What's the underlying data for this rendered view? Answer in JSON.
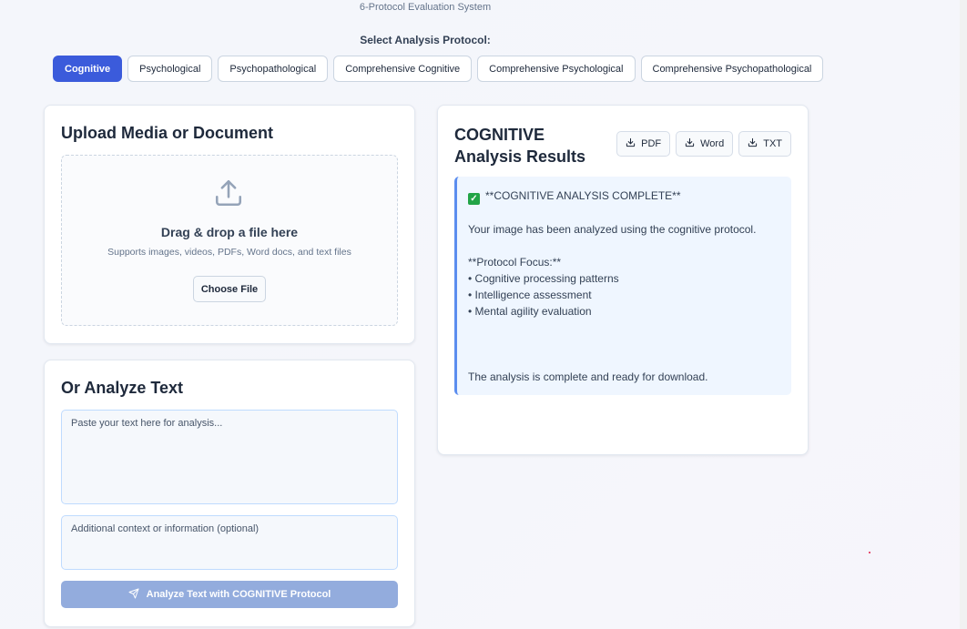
{
  "header": {
    "subtitle": "6-Protocol Evaluation System",
    "protocol_label": "Select Analysis Protocol:"
  },
  "protocols": [
    {
      "label": "Cognitive",
      "active": true
    },
    {
      "label": "Psychological",
      "active": false
    },
    {
      "label": "Psychopathological",
      "active": false
    },
    {
      "label": "Comprehensive Cognitive",
      "active": false
    },
    {
      "label": "Comprehensive Psychological",
      "active": false
    },
    {
      "label": "Comprehensive Psychopathological",
      "active": false
    }
  ],
  "upload": {
    "title": "Upload Media or Document",
    "drop_title": "Drag & drop a file here",
    "drop_subtitle": "Supports images, videos, PDFs, Word docs, and text files",
    "choose_label": "Choose File",
    "icon": "upload-icon"
  },
  "text_analysis": {
    "title": "Or Analyze Text",
    "text_placeholder": "Paste your text here for analysis...",
    "context_placeholder": "Additional context or information (optional)",
    "analyze_label": "Analyze Text with COGNITIVE Protocol",
    "analyze_icon": "send-icon"
  },
  "results": {
    "title": "COGNITIVE Analysis Results",
    "downloads": [
      {
        "label": "PDF",
        "icon": "download-icon"
      },
      {
        "label": "Word",
        "icon": "download-icon"
      },
      {
        "label": "TXT",
        "icon": "download-icon"
      }
    ],
    "lines": {
      "complete": "**COGNITIVE ANALYSIS COMPLETE**",
      "intro": "Your image has been analyzed using the cognitive protocol.",
      "focus_heading": "**Protocol Focus:**",
      "focus_1": "• Cognitive processing patterns",
      "focus_2": "• Intelligence assessment",
      "focus_3": "• Mental agility evaluation",
      "closing": "The analysis is complete and ready for download."
    }
  },
  "colors": {
    "accent": "#3b5bdb",
    "result_bg": "#eff6ff",
    "result_border": "#5b8def",
    "disabled_button": "#93acdd"
  }
}
